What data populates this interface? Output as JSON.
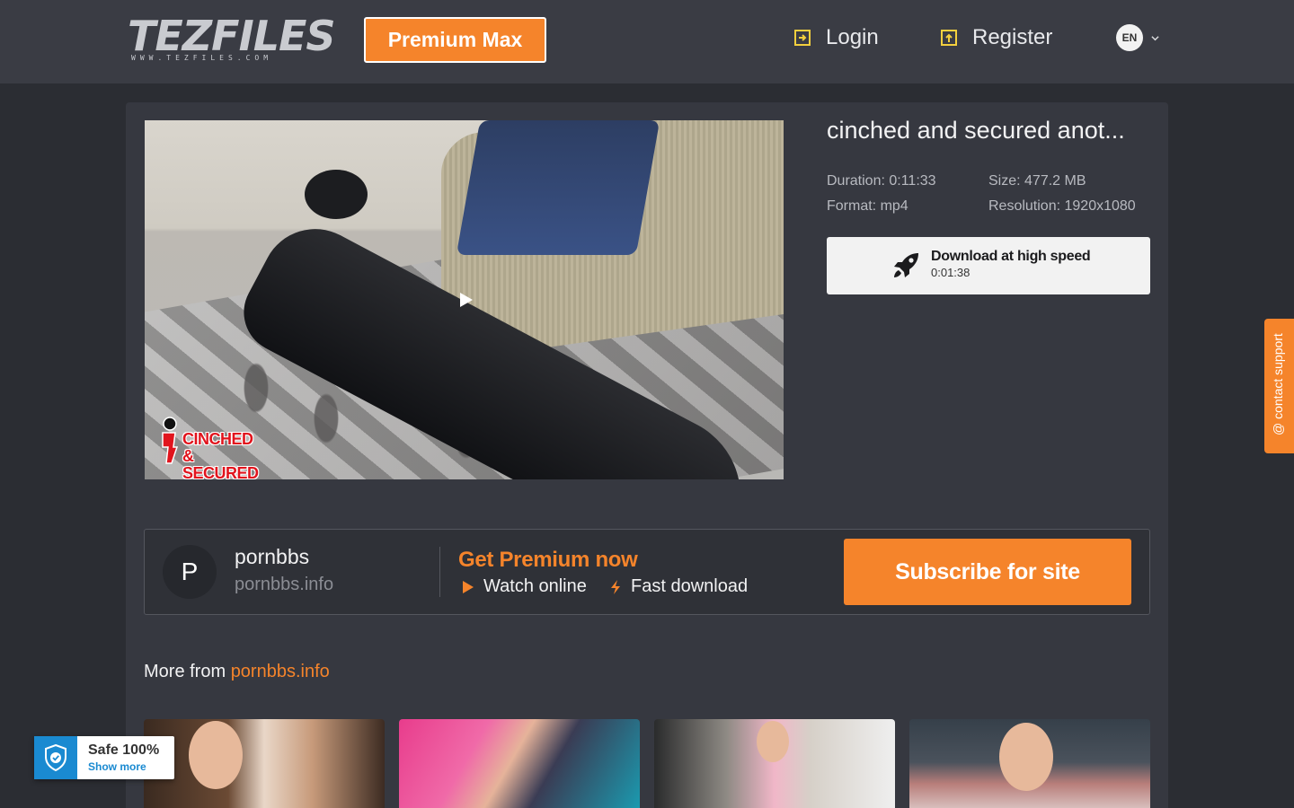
{
  "header": {
    "logo_text": "TEZFILES",
    "logo_sub": "WWW.TEZFILES.COM",
    "premium_label": "Premium Max",
    "login_label": "Login",
    "register_label": "Register",
    "lang_code": "EN"
  },
  "file": {
    "title": "cinched and secured anot...",
    "duration": "Duration: 0:11:33",
    "format": "Format: mp4",
    "size": "Size: 477.2 MB",
    "resolution": "Resolution: 1920x1080",
    "watermark_line1": "CINCHED",
    "watermark_line2": "& SECURED"
  },
  "download": {
    "label": "Download at high speed",
    "time": "0:01:38"
  },
  "uploader": {
    "avatar_letter": "P",
    "name": "pornbbs",
    "site": "pornbbs.info"
  },
  "premium_promo": {
    "title": "Get Premium now",
    "feature_watch": "Watch online",
    "feature_fast": "Fast download",
    "subscribe_label": "Subscribe for site"
  },
  "more_from": {
    "prefix": "More from ",
    "site": "pornbbs.info"
  },
  "support_tab": {
    "label": "@ contact support"
  },
  "safe_badge": {
    "title": "Safe 100%",
    "more": "Show more"
  },
  "colors": {
    "accent": "#f5842b",
    "header_bg": "#3a3c44",
    "page_bg": "#2b2d33",
    "panel_bg": "#363840",
    "safe_blue": "#1a8ad1"
  }
}
